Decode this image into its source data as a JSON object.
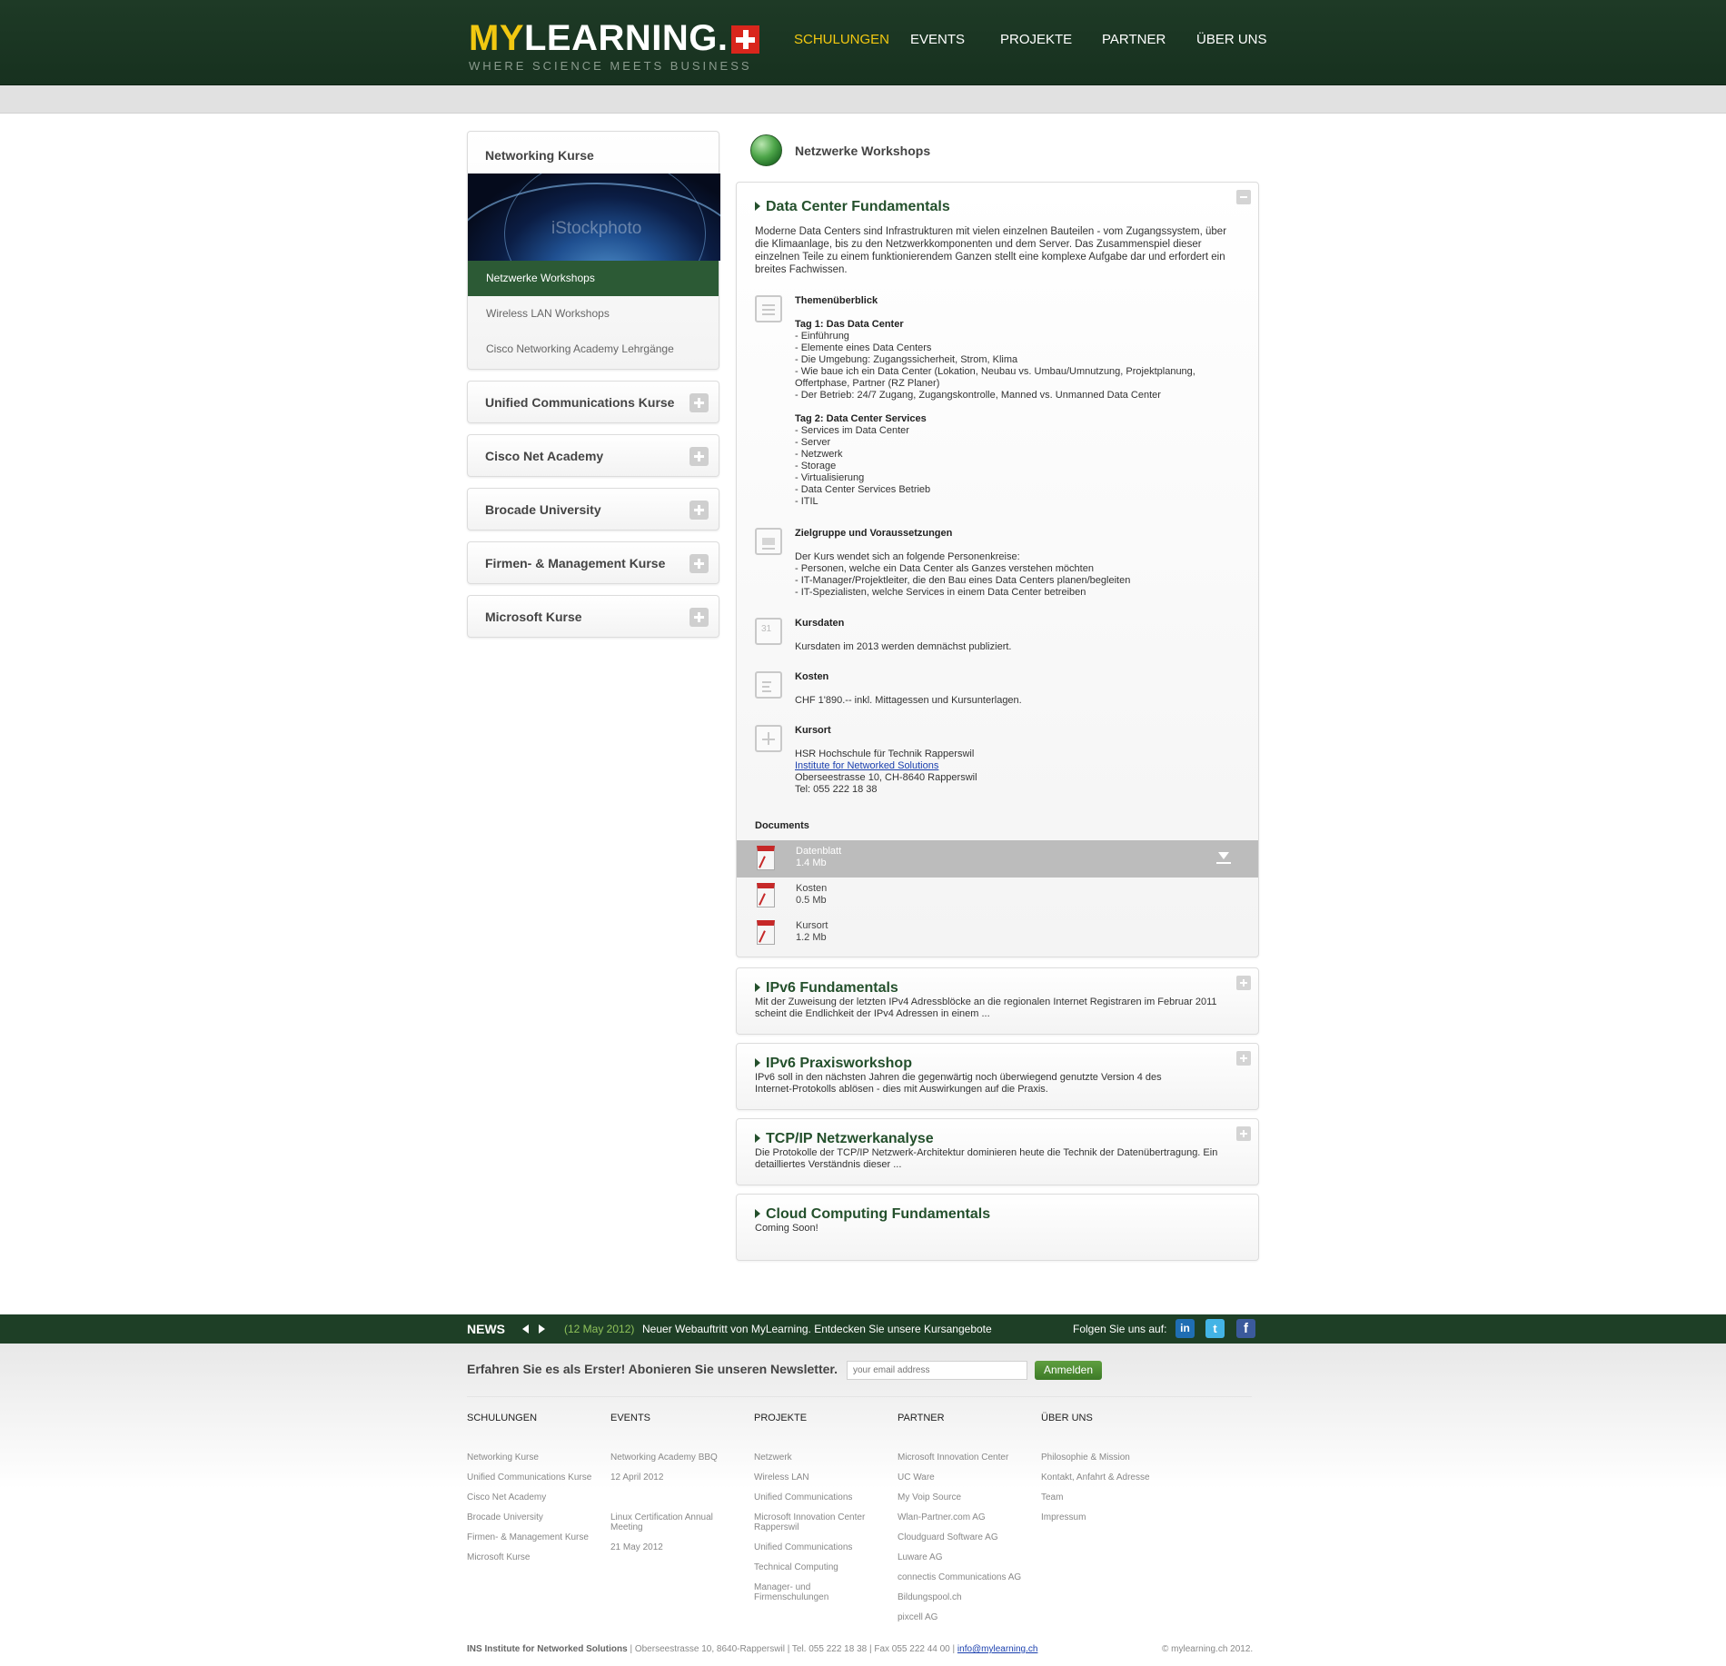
{
  "header": {
    "logo_my": "MY",
    "logo_rest": "LEARNING.",
    "tagline": "WHERE SCIENCE MEETS BUSINESS",
    "nav": [
      "SCHULUNGEN",
      "EVENTS",
      "PROJEKTE",
      "PARTNER",
      "ÜBER UNS"
    ]
  },
  "sidebar": {
    "box_title": "Networking Kurse",
    "image_watermark": "iStockphoto",
    "subitems": [
      "Netzwerke Workshops",
      "Wireless LAN Workshops",
      "Cisco Networking Academy Lehrgänge"
    ],
    "categories": [
      "Unified Communications Kurse",
      "Cisco Net Academy",
      "Brocade University",
      "Firmen- & Management Kurse",
      "Microsoft Kurse"
    ]
  },
  "section": {
    "title": "Netzwerke Workshops"
  },
  "course": {
    "title": "Data Center Fundamentals",
    "intro": "Moderne Data Centers sind Infrastrukturen mit vielen einzelnen Bauteilen - vom Zugangssystem, über die Klimaanlage, bis zu den Netzwerkkomponenten und dem Server. Das Zusammenspiel dieser einzelnen Teile zu einem funktionierendem Ganzen stellt eine komplexe Aufgabe dar und erfordert ein breites Fachwissen.",
    "themen_title": "Themenüberblick",
    "day1_title": "Tag 1: Das Data Center",
    "day1_items": [
      "- Einführung",
      "- Elemente eines Data Centers",
      "- Die Umgebung: Zugangssicherheit, Strom, Klima",
      "- Wie baue ich ein Data Center (Lokation, Neubau vs. Umbau/Umnutzung, Projektplanung, Offertphase, Partner (RZ Planer)",
      "- Der Betrieb: 24/7 Zugang, Zugangskontrolle, Manned vs. Unmanned Data Center"
    ],
    "day2_title": "Tag 2: Data Center Services",
    "day2_items": [
      "- Services im Data Center",
      "- Server",
      "- Netzwerk",
      "- Storage",
      "- Virtualisierung",
      "- Data Center Services Betrieb",
      "- ITIL"
    ],
    "ziel_title": "Zielgruppe und Voraussetzungen",
    "ziel_intro": "Der Kurs wendet sich an folgende Personenkreise:",
    "ziel_items": [
      "- Personen, welche ein Data Center als Ganzes verstehen möchten",
      "- IT-Manager/Projektleiter, die den Bau eines Data Centers planen/begleiten",
      "- IT-Spezialisten, welche Services in einem Data Center betreiben"
    ],
    "kursdaten_title": "Kursdaten",
    "kursdaten_body": "Kursdaten im 2013 werden demnächst publiziert.",
    "kursdaten_icon_label": "31",
    "kosten_title": "Kosten",
    "kosten_body": "CHF 1'890.-- inkl. Mittagessen und Kursunterlagen.",
    "kursort_title": "Kursort",
    "kursort_line1": "HSR Hochschule für Technik Rapperswil",
    "kursort_link": "Institute for Networked Solutions",
    "kursort_line3": "Oberseestrasse 10, CH-8640 Rapperswil",
    "kursort_line4": "Tel: 055 222 18 38",
    "docs_title": "Documents",
    "docs": [
      {
        "name": "Datenblatt",
        "size": "1.4 Mb"
      },
      {
        "name": "Kosten",
        "size": "0.5 Mb"
      },
      {
        "name": "Kursort",
        "size": "1.2 Mb"
      }
    ]
  },
  "others": [
    {
      "title": "IPv6 Fundamentals",
      "text1": "Mit der Zuweisung der letzten IPv4 Adressblöcke an die regionalen Internet Registraren im Februar 2011",
      "text2": "scheint die Endlichkeit der IPv4 Adressen in einem ..."
    },
    {
      "title": "IPv6 Praxisworkshop",
      "text1": "IPv6 soll in den nächsten Jahren die gegenwärtig noch überwiegend genutzte Version 4 des",
      "text2": "Internet-Protokolls ablösen - dies mit Auswirkungen auf die Praxis."
    },
    {
      "title": "TCP/IP Netzwerkanalyse",
      "text1": "Die Protokolle der TCP/IP Netzwerk-Architektur dominieren heute die Technik der Datenübertragung. Ein",
      "text2": "detailliertes Verständnis dieser ..."
    },
    {
      "title": "Cloud Computing Fundamentals",
      "text1": "Coming Soon!",
      "text2": ""
    }
  ],
  "news": {
    "label": "NEWS",
    "date": "(12 May 2012)",
    "text": "Neuer Webauftritt von MyLearning. Entdecken Sie unsere Kursangebote",
    "follow": "Folgen Sie uns auf:",
    "social": [
      "in",
      "t",
      "f"
    ]
  },
  "newsletter": {
    "text": "Erfahren Sie es als Erster! Abonieren Sie unseren Newsletter.",
    "placeholder": "your email address",
    "button": "Anmelden"
  },
  "footer": {
    "schulungen": {
      "head": "SCHULUNGEN",
      "items": [
        "Networking Kurse",
        "Unified Communications Kurse",
        "Cisco Net Academy",
        "Brocade University",
        "Firmen- & Management Kurse",
        "Microsoft Kurse"
      ]
    },
    "events": {
      "head": "EVENTS",
      "e1": "Networking Academy BBQ",
      "d1": "12 April 2012",
      "e2a": "Linux Certification Annual",
      "e2b": "Meeting",
      "d2": "21 May 2012"
    },
    "projekte": {
      "head": "PROJEKTE",
      "items": [
        "Netzwerk",
        "Wireless LAN",
        "Unified Communications",
        "Microsoft Innovation Center",
        "Rapperswil",
        "Unified Communications",
        "Technical Computing",
        "Manager- und",
        "Firmenschulungen"
      ]
    },
    "partner": {
      "head": "PARTNER",
      "items": [
        "Microsoft Innovation Center",
        "UC Ware",
        "My Voip Source",
        "Wlan-Partner.com AG",
        "Cloudguard Software AG",
        "Luware AG",
        "connectis Communications AG",
        "Bildungspool.ch",
        "pixcell AG"
      ]
    },
    "ueber": {
      "head": "ÜBER UNS",
      "items": [
        "Philosophie & Mission",
        "Kontakt, Anfahrt & Adresse",
        "Team",
        "Impressum"
      ]
    },
    "address_name": "INS Institute for Networked Solutions",
    "address_rest": " | Oberseestrasse 10, 8640-Rapperswil | Tel. 055 222 18 38 | Fax 055 222 44 00 | ",
    "email": "info@mylearning.ch",
    "copyright": "© mylearning.ch 2012."
  },
  "colors": {
    "header_green": "#1e3a26",
    "accent_yellow": "#f2c811",
    "dark_green": "#2c5a35",
    "title_green": "#24502c",
    "button_green": "#4a8a33"
  }
}
